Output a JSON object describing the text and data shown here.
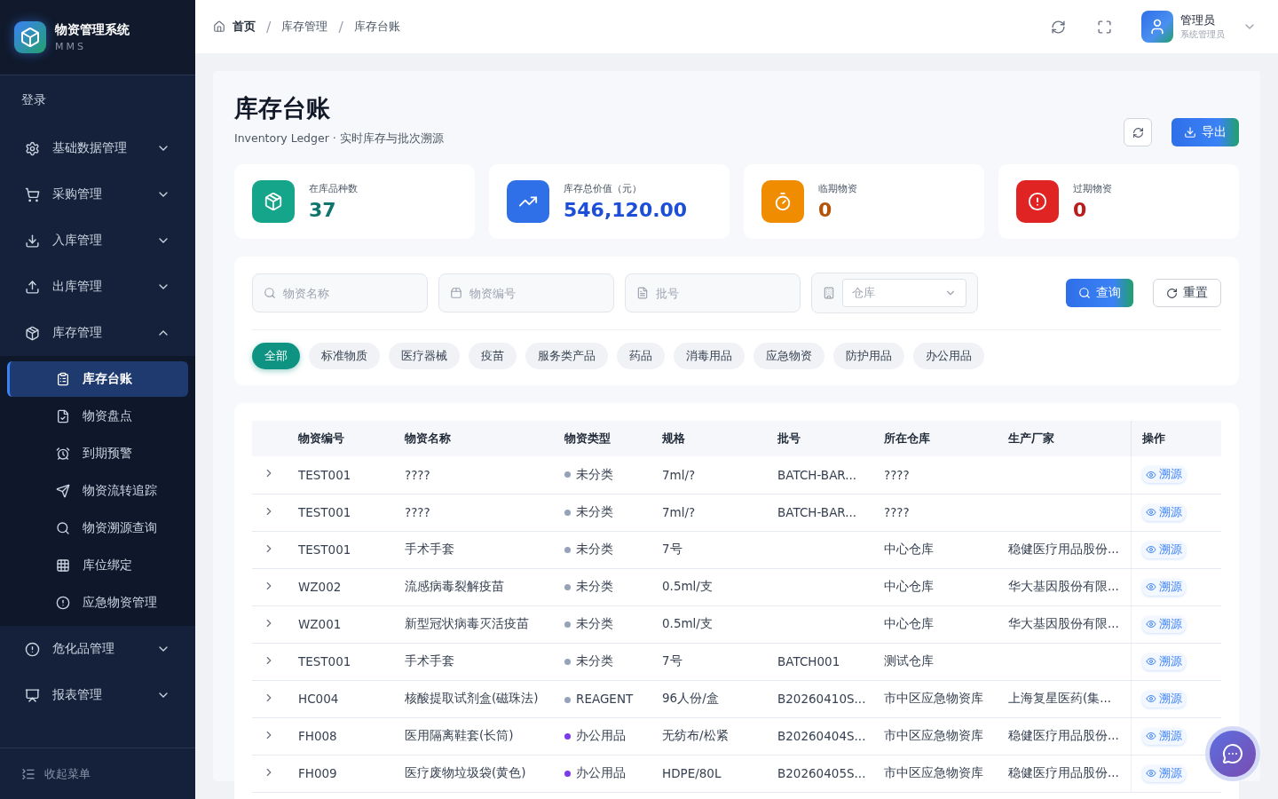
{
  "brand": {
    "title": "物资管理系统",
    "subtitle": "MMS"
  },
  "sidebar": {
    "login": "登录",
    "items": [
      {
        "label": "基础数据管理",
        "expanded": false
      },
      {
        "label": "采购管理",
        "expanded": false
      },
      {
        "label": "入库管理",
        "expanded": false
      },
      {
        "label": "出库管理",
        "expanded": false
      },
      {
        "label": "库存管理",
        "expanded": true,
        "children": [
          {
            "label": "库存台账",
            "selected": true
          },
          {
            "label": "物资盘点",
            "selected": false
          },
          {
            "label": "到期预警",
            "selected": false
          },
          {
            "label": "物资流转追踪",
            "selected": false
          },
          {
            "label": "物资溯源查询",
            "selected": false
          },
          {
            "label": "库位绑定",
            "selected": false
          },
          {
            "label": "应急物资管理",
            "selected": false
          }
        ]
      },
      {
        "label": "危化品管理",
        "expanded": false
      },
      {
        "label": "报表管理",
        "expanded": false
      }
    ],
    "collapse": "收起菜单"
  },
  "breadcrumb": [
    {
      "label": "首页"
    },
    {
      "separator": "/",
      "label": "库存管理"
    },
    {
      "separator": "/",
      "label": "库存台账"
    }
  ],
  "user": {
    "name": "管理员",
    "role": "系统管理员"
  },
  "page": {
    "title": "库存台账",
    "subtitle": "Inventory Ledger · 实时库存与批次溯源",
    "export": "导出"
  },
  "stats": [
    {
      "label": "在库品种数",
      "value": "37",
      "color": "#14a58a"
    },
    {
      "label": "库存总价值（元）",
      "value": "546,120.00",
      "color": "#2f6fe8"
    },
    {
      "label": "临期物资",
      "value": "0",
      "color": "#f08c00"
    },
    {
      "label": "过期物资",
      "value": "0",
      "color": "#e02424"
    }
  ],
  "filters": {
    "name": {
      "placeholder": "物资名称"
    },
    "code": {
      "placeholder": "物资编号"
    },
    "batch": {
      "placeholder": "批号"
    },
    "warehouse": {
      "placeholder": "仓库"
    },
    "query": "查询",
    "reset": "重置"
  },
  "categories": [
    {
      "label": "全部",
      "selected": true
    },
    {
      "label": "标准物质",
      "selected": false
    },
    {
      "label": "医疗器械",
      "selected": false
    },
    {
      "label": "疫苗",
      "selected": false
    },
    {
      "label": "服务类产品",
      "selected": false
    },
    {
      "label": "药品",
      "selected": false
    },
    {
      "label": "消毒用品",
      "selected": false
    },
    {
      "label": "应急物资",
      "selected": false
    },
    {
      "label": "防护用品",
      "selected": false
    },
    {
      "label": "办公用品",
      "selected": false
    }
  ],
  "table": {
    "columns": [
      "物资编号",
      "物资名称",
      "物资类型",
      "规格",
      "批号",
      "所在仓库",
      "生产厂家",
      "操作"
    ],
    "rows": [
      {
        "code": "TEST001",
        "name": "????",
        "type": "未分类",
        "color": "#94a3b8",
        "spec": "7ml/?",
        "batch": "BATCH-BAR...",
        "warehouse": "????",
        "action": "溯源"
      },
      {
        "code": "TEST001",
        "name": "????",
        "type": "未分类",
        "color": "#94a3b8",
        "spec": "7ml/?",
        "batch": "BATCH-BAR...",
        "warehouse": "????",
        "action": "溯源"
      },
      {
        "code": "TEST001",
        "name": "手术手套",
        "type": "未分类",
        "color": "#94a3b8",
        "spec": "7号",
        "warehouse": "中心仓库",
        "maker": "稳健医疗用品股份...",
        "action": "溯源"
      },
      {
        "code": "WZ002",
        "name": "流感病毒裂解疫苗",
        "type": "未分类",
        "color": "#94a3b8",
        "spec": "0.5ml/支",
        "warehouse": "中心仓库",
        "maker": "华大基因股份有限...",
        "action": "溯源"
      },
      {
        "code": "WZ001",
        "name": "新型冠状病毒灭活疫苗",
        "type": "未分类",
        "color": "#94a3b8",
        "spec": "0.5ml/支",
        "warehouse": "中心仓库",
        "maker": "华大基因股份有限...",
        "action": "溯源"
      },
      {
        "code": "TEST001",
        "name": "手术手套",
        "type": "未分类",
        "color": "#94a3b8",
        "spec": "7号",
        "batch": "BATCH001",
        "warehouse": "测试仓库",
        "action": "溯源"
      },
      {
        "code": "HC004",
        "name": "核酸提取试剂盒(磁珠法)",
        "type": "REAGENT",
        "color": "#94a3b8",
        "spec": "96人份/盒",
        "batch": "B20260410S...",
        "warehouse": "市中区应急物资库",
        "maker": "上海复星医药(集...",
        "action": "溯源"
      },
      {
        "code": "FH008",
        "name": "医用隔离鞋套(长筒)",
        "type": "办公用品",
        "color": "#7c3aed",
        "spec": "无纺布/松紧",
        "batch": "B20260404S...",
        "warehouse": "市中区应急物资库",
        "maker": "稳健医疗用品股份...",
        "action": "溯源"
      },
      {
        "code": "FH009",
        "name": "医疗废物垃圾袋(黄色)",
        "type": "办公用品",
        "color": "#7c3aed",
        "spec": "HDPE/80L",
        "batch": "B20260405S...",
        "warehouse": "市中区应急物资库",
        "maker": "稳健医疗用品股份...",
        "action": "溯源"
      }
    ]
  }
}
